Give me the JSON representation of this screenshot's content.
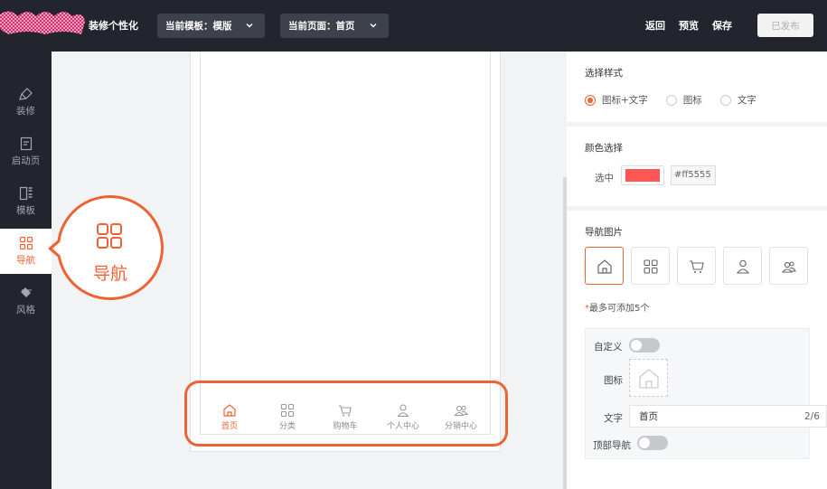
{
  "header": {
    "app_title": "装修个性化",
    "template_select": "当前模板：模版",
    "page_select": "当前页面：首页",
    "links": {
      "back": "返回",
      "preview": "预览",
      "save": "保存"
    },
    "publish_label": "已发布"
  },
  "sidebar": {
    "items": [
      {
        "label": "装修",
        "icon": "brush-icon"
      },
      {
        "label": "启动页",
        "icon": "document-icon"
      },
      {
        "label": "模板",
        "icon": "template-icon"
      },
      {
        "label": "导航",
        "icon": "grid-icon",
        "active": true
      },
      {
        "label": "风格",
        "icon": "paint-bucket-icon"
      }
    ]
  },
  "callout": {
    "label": "导航"
  },
  "tabbar": {
    "tabs": [
      {
        "label": "首页",
        "icon": "home-icon",
        "active": true
      },
      {
        "label": "分类",
        "icon": "grid-icon"
      },
      {
        "label": "购物车",
        "icon": "cart-icon"
      },
      {
        "label": "个人中心",
        "icon": "user-icon"
      },
      {
        "label": "分销中心",
        "icon": "group-icon"
      }
    ]
  },
  "style_section": {
    "title": "选择样式",
    "options": [
      "图标+文字",
      "图标",
      "文字"
    ],
    "selected": "图标+文字"
  },
  "color_section": {
    "title": "颜色选择",
    "selected_label": "选中",
    "selected_color": "#ff5555",
    "hex_value": "#ff5555"
  },
  "nav_images": {
    "title": "导航图片",
    "icons": [
      "home-icon",
      "grid-icon",
      "cart-icon",
      "user-icon",
      "group-icon"
    ],
    "hint_star": "*",
    "hint": "最多可添加5个"
  },
  "config": {
    "custom_label": "自定义",
    "icon_label": "图标",
    "text_label": "文字",
    "text_value": "首页",
    "text_count": "2/6",
    "top_nav_label": "顶部导航"
  },
  "colors": {
    "accent": "#ef6233",
    "dark": "#22252e"
  }
}
